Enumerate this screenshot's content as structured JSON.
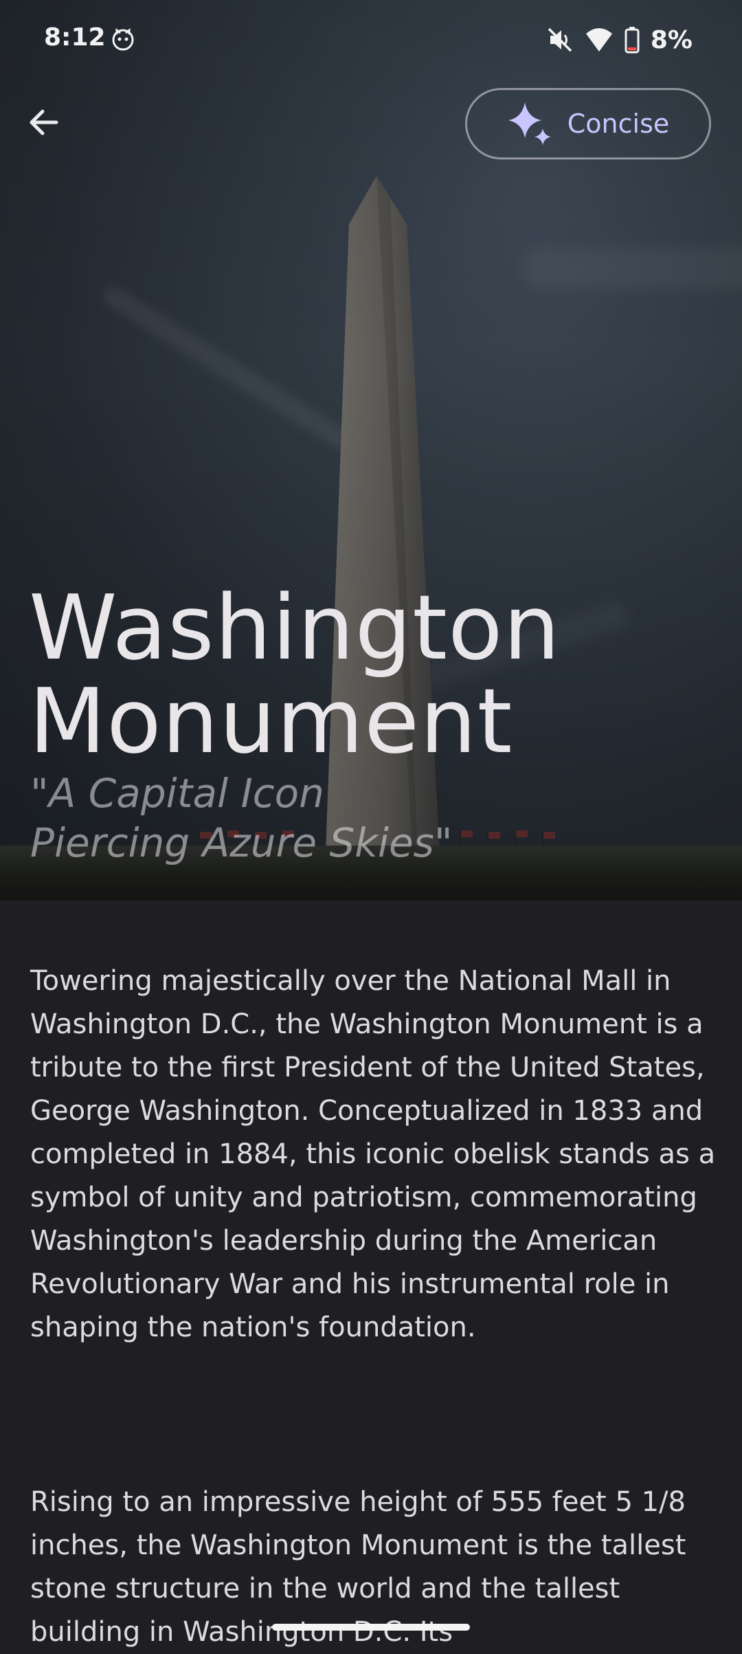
{
  "status_bar": {
    "time": "8:12",
    "battery_percent": "8%"
  },
  "header": {
    "mode_button_label": "Concise"
  },
  "article": {
    "title_line1": "Washington",
    "title_line2": "Monument",
    "tagline_line1": "\"A Capital Icon",
    "tagline_line2": "Piercing Azure Skies\"",
    "paragraph1": "Towering majestically over the National Mall in Washington D.C., the Washington Monument is a tribute to the first President of the United States, George Washington. Conceptualized in 1833 and completed in 1884, this iconic obelisk stands as a symbol of unity and patriotism, commemorating Washington's leadership during the American Revolutionary War and his instrumental role in shaping the nation's foundation.",
    "paragraph2": "Rising to an impressive height of 555 feet 5 1/8 inches, the Washington Monument is the tallest stone structure in the world and the tallest building in Washington D.C. Its"
  },
  "colors": {
    "accent": "#c9c5ff",
    "background": "#1f1f23",
    "text": "#dedbe0"
  }
}
